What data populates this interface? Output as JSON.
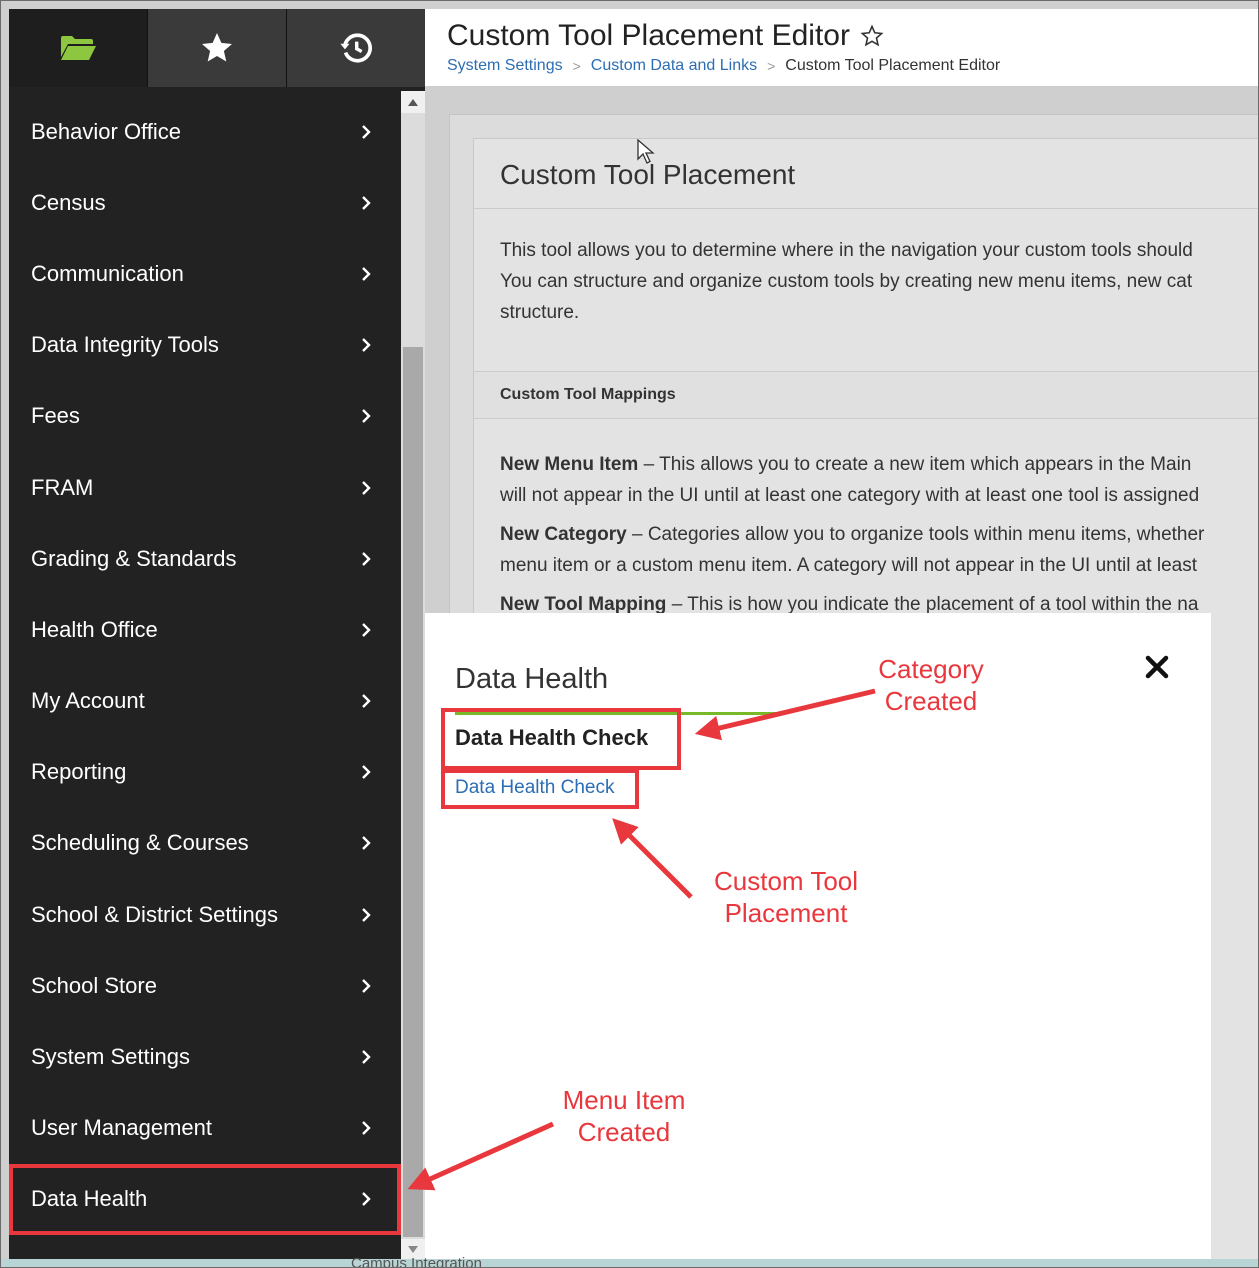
{
  "sidebar": {
    "tabs": [
      {
        "icon": "folder-icon",
        "color": "#8dc63f"
      },
      {
        "icon": "star-icon",
        "color": "#ffffff"
      },
      {
        "icon": "history-icon",
        "color": "#ffffff"
      }
    ],
    "items": [
      {
        "label": "Behavior Office"
      },
      {
        "label": "Census"
      },
      {
        "label": "Communication"
      },
      {
        "label": "Data Integrity Tools"
      },
      {
        "label": "Fees"
      },
      {
        "label": "FRAM"
      },
      {
        "label": "Grading & Standards"
      },
      {
        "label": "Health Office"
      },
      {
        "label": "My Account"
      },
      {
        "label": "Reporting"
      },
      {
        "label": "Scheduling & Courses"
      },
      {
        "label": "School & District Settings"
      },
      {
        "label": "School Store"
      },
      {
        "label": "System Settings"
      },
      {
        "label": "User Management"
      },
      {
        "label": "Data Health"
      }
    ]
  },
  "header": {
    "title": "Custom Tool Placement Editor",
    "breadcrumb": [
      "System Settings",
      "Custom Data and Links",
      "Custom Tool Placement Editor"
    ]
  },
  "main": {
    "card_title": "Custom Tool Placement",
    "intro_lines": [
      "This tool allows you to determine where in the navigation your custom tools should",
      "You can structure and organize custom tools by creating new menu items, new cat",
      "structure."
    ],
    "section_label": "Custom Tool Mappings",
    "defs": [
      {
        "term": "New Menu Item",
        "line1": " – This allows you to create a new item which appears in the Main",
        "line2": "will not appear in the UI until at least one category with at least one tool is assigned"
      },
      {
        "term": "New Category",
        "line1": " – Categories allow you to organize tools within menu items, whether",
        "line2": "menu item or a custom menu item. A category will not appear in the UI until at least"
      },
      {
        "term": "New Tool Mapping",
        "line1": " – This is how you indicate the placement of a tool within the na",
        "line2": ""
      }
    ]
  },
  "modal": {
    "title": "Data Health",
    "category": "Data Health Check",
    "tool_link": "Data Health Check"
  },
  "annotations": {
    "category_created": [
      "Category",
      "Created"
    ],
    "custom_tool_placement": [
      "Custom Tool",
      "Placement"
    ],
    "menu_item_created": [
      "Menu Item",
      "Created"
    ]
  },
  "footer": {
    "partial_text": "Campus Integration"
  },
  "colors": {
    "annotation_red": "#e8373d",
    "link_blue": "#2c6db3",
    "accent_green": "#78b928",
    "sidebar_bg": "#222222"
  }
}
